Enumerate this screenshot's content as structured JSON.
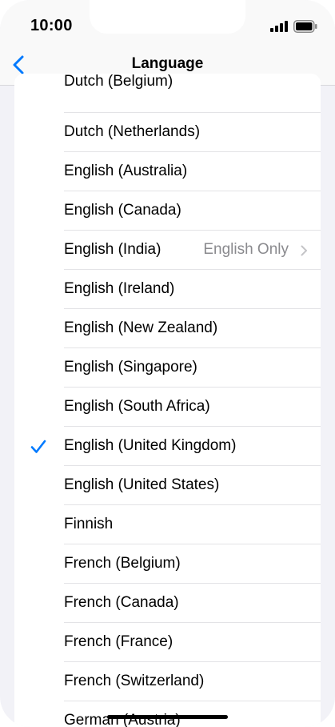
{
  "status": {
    "time": "10:00"
  },
  "nav": {
    "title": "Language",
    "back_icon": "chevron-left-icon"
  },
  "languages": [
    {
      "label": "Dutch (Belgium)"
    },
    {
      "label": "Dutch (Netherlands)"
    },
    {
      "label": "English (Australia)"
    },
    {
      "label": "English (Canada)"
    },
    {
      "label": "English (India)",
      "detail": "English Only"
    },
    {
      "label": "English (Ireland)"
    },
    {
      "label": "English (New Zealand)"
    },
    {
      "label": "English (Singapore)"
    },
    {
      "label": "English (South Africa)"
    },
    {
      "label": "English (United Kingdom)",
      "selected": true
    },
    {
      "label": "English (United States)"
    },
    {
      "label": "Finnish"
    },
    {
      "label": "French (Belgium)"
    },
    {
      "label": "French (Canada)"
    },
    {
      "label": "French (France)"
    },
    {
      "label": "French (Switzerland)"
    },
    {
      "label": "German (Austria)"
    }
  ],
  "colors": {
    "accent": "#007aff",
    "background": "#f2f2f7",
    "detail_text": "#8a8a8e"
  }
}
